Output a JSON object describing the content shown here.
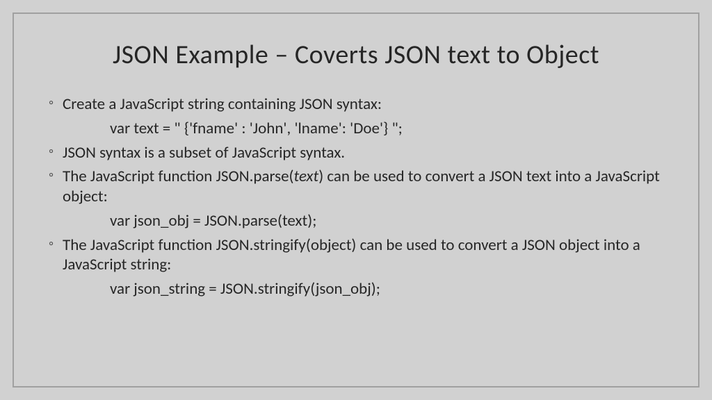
{
  "title": "JSON Example – Coverts JSON text to Object",
  "items": [
    {
      "text": "Create a JavaScript string containing JSON syntax:",
      "sub": "var text = \" {'fname' : 'John', 'lname': 'Doe'} \";"
    },
    {
      "text": "JSON syntax is a subset of JavaScript syntax."
    },
    {
      "pre": "The JavaScript function JSON.parse(",
      "ital": "text",
      "post": ") can be used to convert a JSON text into a JavaScript object:",
      "sub": "var json_obj = JSON.parse(text);"
    },
    {
      "text": "The JavaScript function JSON.stringify(object) can be used to convert a JSON object into a JavaScript string:",
      "sub": "var json_string = JSON.stringify(json_obj);"
    }
  ]
}
